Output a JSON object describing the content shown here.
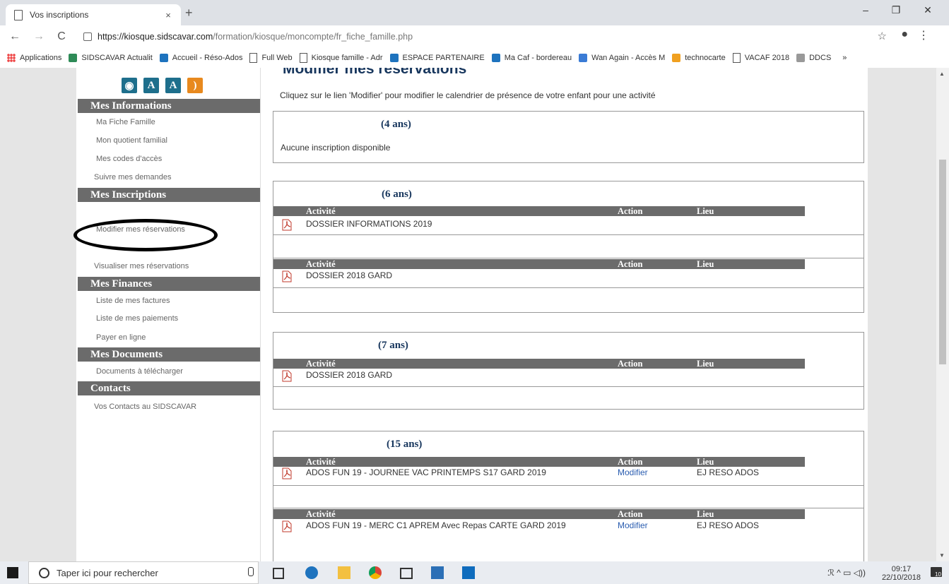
{
  "browser": {
    "tab_title": "Vos inscriptions",
    "tab_close": "×",
    "new_tab": "+",
    "url_host": "https://kiosque.sidscavar.com",
    "url_path": "/formation/kiosque/moncompte/fr_fiche_famille.php",
    "win_minimize": "–",
    "win_restore": "❐",
    "win_close": "✕",
    "back": "←",
    "forward": "→",
    "reload": "C",
    "star": "☆",
    "more": "⋮",
    "bookmarks": [
      {
        "label": "Applications",
        "icon": "apps-grid-icon"
      },
      {
        "label": "SIDSCAVAR Actualit",
        "icon": "sidscavar-icon"
      },
      {
        "label": "Accueil - Réso-Ados",
        "icon": "reso-ados-icon"
      },
      {
        "label": "Full Web",
        "icon": "page-icon"
      },
      {
        "label": "Kiosque famille - Adr",
        "icon": "page-icon"
      },
      {
        "label": "ESPACE PARTENAIRE",
        "icon": "caf-icon"
      },
      {
        "label": "Ma Caf - bordereau",
        "icon": "caf-icon"
      },
      {
        "label": "Wan Again - Accès M",
        "icon": "wan-icon"
      },
      {
        "label": "technocarte",
        "icon": "technocarte-icon"
      },
      {
        "label": "VACAF 2018",
        "icon": "page-icon"
      },
      {
        "label": "DDCS",
        "icon": "ddcs-icon"
      }
    ],
    "bookmarks_more": "»"
  },
  "sidebar": {
    "accessibility_title": "Accessibilité",
    "sections": {
      "informations": {
        "title": "Mes Informations",
        "items": [
          "Ma Fiche Famille",
          "Mon quotient familial",
          "Mes codes d'accès",
          "Suivre mes demandes"
        ]
      },
      "inscriptions": {
        "title": "Mes Inscriptions",
        "items": [
          "Modifier mes réservations",
          "Visualiser mes réservations"
        ]
      },
      "finances": {
        "title": "Mes Finances",
        "items": [
          "Liste de mes factures",
          "Liste de mes paiements",
          "Payer en ligne"
        ]
      },
      "documents": {
        "title": "Mes Documents",
        "items": [
          "Documents à télécharger"
        ]
      },
      "contacts": {
        "title": "Contacts",
        "items": [
          "Vos Contacts au SIDSCAVAR"
        ]
      }
    }
  },
  "main": {
    "title": "Modifier mes réservations",
    "intro": "Cliquez sur le lien 'Modifier' pour modifier le calendrier de présence de votre enfant pour une activité",
    "headers": {
      "activity": "Activité",
      "action": "Action",
      "place": "Lieu"
    },
    "children": [
      {
        "age": "(4 ans)",
        "empty": "Aucune inscription disponible"
      },
      {
        "age": "(6 ans)",
        "rows": [
          {
            "activity": "DOSSIER INFORMATIONS 2019",
            "action": "",
            "place": ""
          },
          {
            "activity": "DOSSIER 2018 GARD",
            "action": "",
            "place": ""
          }
        ]
      },
      {
        "age": "(7 ans)",
        "rows": [
          {
            "activity": "DOSSIER 2018 GARD",
            "action": "",
            "place": ""
          }
        ]
      },
      {
        "age": "(15 ans)",
        "rows": [
          {
            "activity": "ADOS FUN 19 - JOURNEE VAC PRINTEMPS S17 GARD 2019",
            "action": "Modifier",
            "place": "EJ RESO ADOS"
          },
          {
            "activity": "ADOS FUN 19 - MERC C1 APREM Avec Repas CARTE GARD 2019",
            "action": "Modifier",
            "place": "EJ RESO ADOS"
          }
        ]
      }
    ]
  },
  "taskbar": {
    "search_placeholder": "Taper ici pour rechercher",
    "time": "09:17",
    "date": "22/10/2018",
    "notif_count": "10"
  },
  "colors": {
    "section_bg": "#6b6b6b",
    "title": "#17365d",
    "link": "#2a5db0",
    "accent_rss": "#e8891e"
  }
}
